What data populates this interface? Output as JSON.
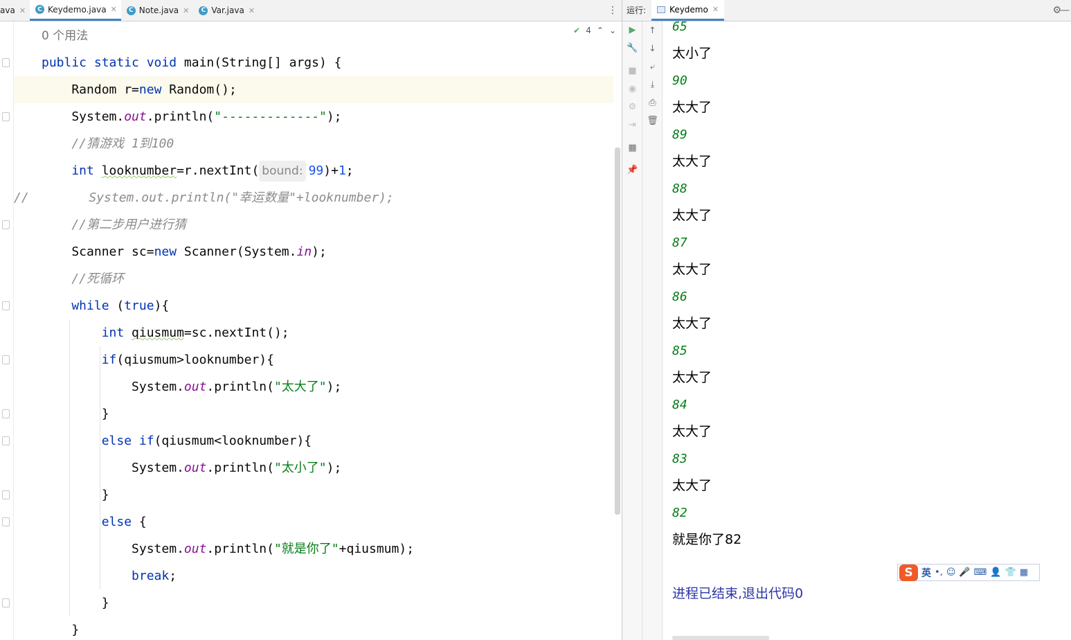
{
  "editor": {
    "tabs": [
      {
        "label": "ava",
        "partial": true
      },
      {
        "label": "Keydemo.java",
        "active": true
      },
      {
        "label": "Note.java"
      },
      {
        "label": "Var.java"
      }
    ],
    "inspection_count": "4",
    "usages_hint": "0 个用法",
    "lines": [
      [
        {
          "t": "usages",
          "v": "0 个用法"
        }
      ],
      [
        {
          "t": "kw",
          "v": "public static void "
        },
        {
          "t": "plain",
          "v": "main(String[] args) {"
        }
      ],
      [
        {
          "t": "plain",
          "v": "    Random r="
        },
        {
          "t": "kw",
          "v": "new "
        },
        {
          "t": "plain",
          "v": "Random();"
        }
      ],
      [
        {
          "t": "plain",
          "v": "    System."
        },
        {
          "t": "fld",
          "v": "out"
        },
        {
          "t": "plain",
          "v": ".println("
        },
        {
          "t": "str",
          "v": "\"-------------\""
        },
        {
          "t": "plain",
          "v": ");"
        }
      ],
      [
        {
          "t": "cmt",
          "v": "    //猜游戏 1到100"
        }
      ],
      [
        {
          "t": "kw",
          "v": "    int "
        },
        {
          "t": "sq",
          "v": "looknumber"
        },
        {
          "t": "plain",
          "v": "=r.nextInt("
        },
        {
          "t": "hint",
          "v": "bound:"
        },
        {
          "t": "num",
          "v": "99"
        },
        {
          "t": "plain",
          "v": ")+"
        },
        {
          "t": "num",
          "v": "1"
        },
        {
          "t": "plain",
          "v": ";"
        }
      ],
      [
        {
          "t": "cmt",
          "v": "//        System.out.println(\"幸运数量\"+looknumber);"
        }
      ],
      [
        {
          "t": "cmt",
          "v": "    //第二步用户进行猜"
        }
      ],
      [
        {
          "t": "plain",
          "v": "    Scanner sc="
        },
        {
          "t": "kw",
          "v": "new "
        },
        {
          "t": "plain",
          "v": "Scanner(System."
        },
        {
          "t": "fld",
          "v": "in"
        },
        {
          "t": "plain",
          "v": ");"
        }
      ],
      [
        {
          "t": "cmt",
          "v": "    //死循环"
        }
      ],
      [
        {
          "t": "kw",
          "v": "    while "
        },
        {
          "t": "plain",
          "v": "("
        },
        {
          "t": "kw",
          "v": "true"
        },
        {
          "t": "plain",
          "v": "){"
        }
      ],
      [
        {
          "t": "kw",
          "v": "        int "
        },
        {
          "t": "sq",
          "v": "qiusmum"
        },
        {
          "t": "plain",
          "v": "=sc.nextInt();"
        }
      ],
      [
        {
          "t": "kw",
          "v": "        if"
        },
        {
          "t": "plain",
          "v": "(qiusmum>looknumber){"
        }
      ],
      [
        {
          "t": "plain",
          "v": "            System."
        },
        {
          "t": "fld",
          "v": "out"
        },
        {
          "t": "plain",
          "v": ".println("
        },
        {
          "t": "str",
          "v": "\"太大了\""
        },
        {
          "t": "plain",
          "v": ");"
        }
      ],
      [
        {
          "t": "plain",
          "v": "        }"
        }
      ],
      [
        {
          "t": "kw",
          "v": "        else if"
        },
        {
          "t": "plain",
          "v": "(qiusmum<looknumber){"
        }
      ],
      [
        {
          "t": "plain",
          "v": "            System."
        },
        {
          "t": "fld",
          "v": "out"
        },
        {
          "t": "plain",
          "v": ".println("
        },
        {
          "t": "str",
          "v": "\"太小了\""
        },
        {
          "t": "plain",
          "v": ");"
        }
      ],
      [
        {
          "t": "plain",
          "v": "        }"
        }
      ],
      [
        {
          "t": "kw",
          "v": "        else "
        },
        {
          "t": "plain",
          "v": "{"
        }
      ],
      [
        {
          "t": "plain",
          "v": "            System."
        },
        {
          "t": "fld",
          "v": "out"
        },
        {
          "t": "plain",
          "v": ".println("
        },
        {
          "t": "str",
          "v": "\"就是你了\""
        },
        {
          "t": "plain",
          "v": "+qiusmum);"
        }
      ],
      [
        {
          "t": "kw",
          "v": "            break"
        },
        {
          "t": "plain",
          "v": ";"
        }
      ],
      [
        {
          "t": "plain",
          "v": "        }"
        }
      ],
      [
        {
          "t": "plain",
          "v": "    }"
        }
      ]
    ]
  },
  "run_panel": {
    "label": "运行:",
    "tab": "Keydemo",
    "settings_icon": "gear-icon",
    "console": [
      {
        "text": "65",
        "type": "input"
      },
      {
        "text": "太小了",
        "type": "output"
      },
      {
        "text": "90",
        "type": "input"
      },
      {
        "text": "太大了",
        "type": "output"
      },
      {
        "text": "89",
        "type": "input"
      },
      {
        "text": "太大了",
        "type": "output"
      },
      {
        "text": "88",
        "type": "input"
      },
      {
        "text": "太大了",
        "type": "output"
      },
      {
        "text": "87",
        "type": "input"
      },
      {
        "text": "太大了",
        "type": "output"
      },
      {
        "text": "86",
        "type": "input"
      },
      {
        "text": "太大了",
        "type": "output"
      },
      {
        "text": "85",
        "type": "input"
      },
      {
        "text": "太大了",
        "type": "output"
      },
      {
        "text": "84",
        "type": "input"
      },
      {
        "text": "太大了",
        "type": "output"
      },
      {
        "text": "83",
        "type": "input"
      },
      {
        "text": "太大了",
        "type": "output"
      },
      {
        "text": "82",
        "type": "input"
      },
      {
        "text": "就是你了82",
        "type": "output"
      },
      {
        "text": "",
        "type": "blank"
      },
      {
        "text": "进程已结束,退出代码0",
        "type": "exit"
      }
    ]
  },
  "ime": {
    "logo": "S",
    "lang": "英"
  },
  "colors": {
    "keyword": "#0033b3",
    "string": "#067d17",
    "field": "#871094",
    "number": "#1750eb",
    "comment": "#8c8c8c",
    "accent": "#4083c9"
  }
}
